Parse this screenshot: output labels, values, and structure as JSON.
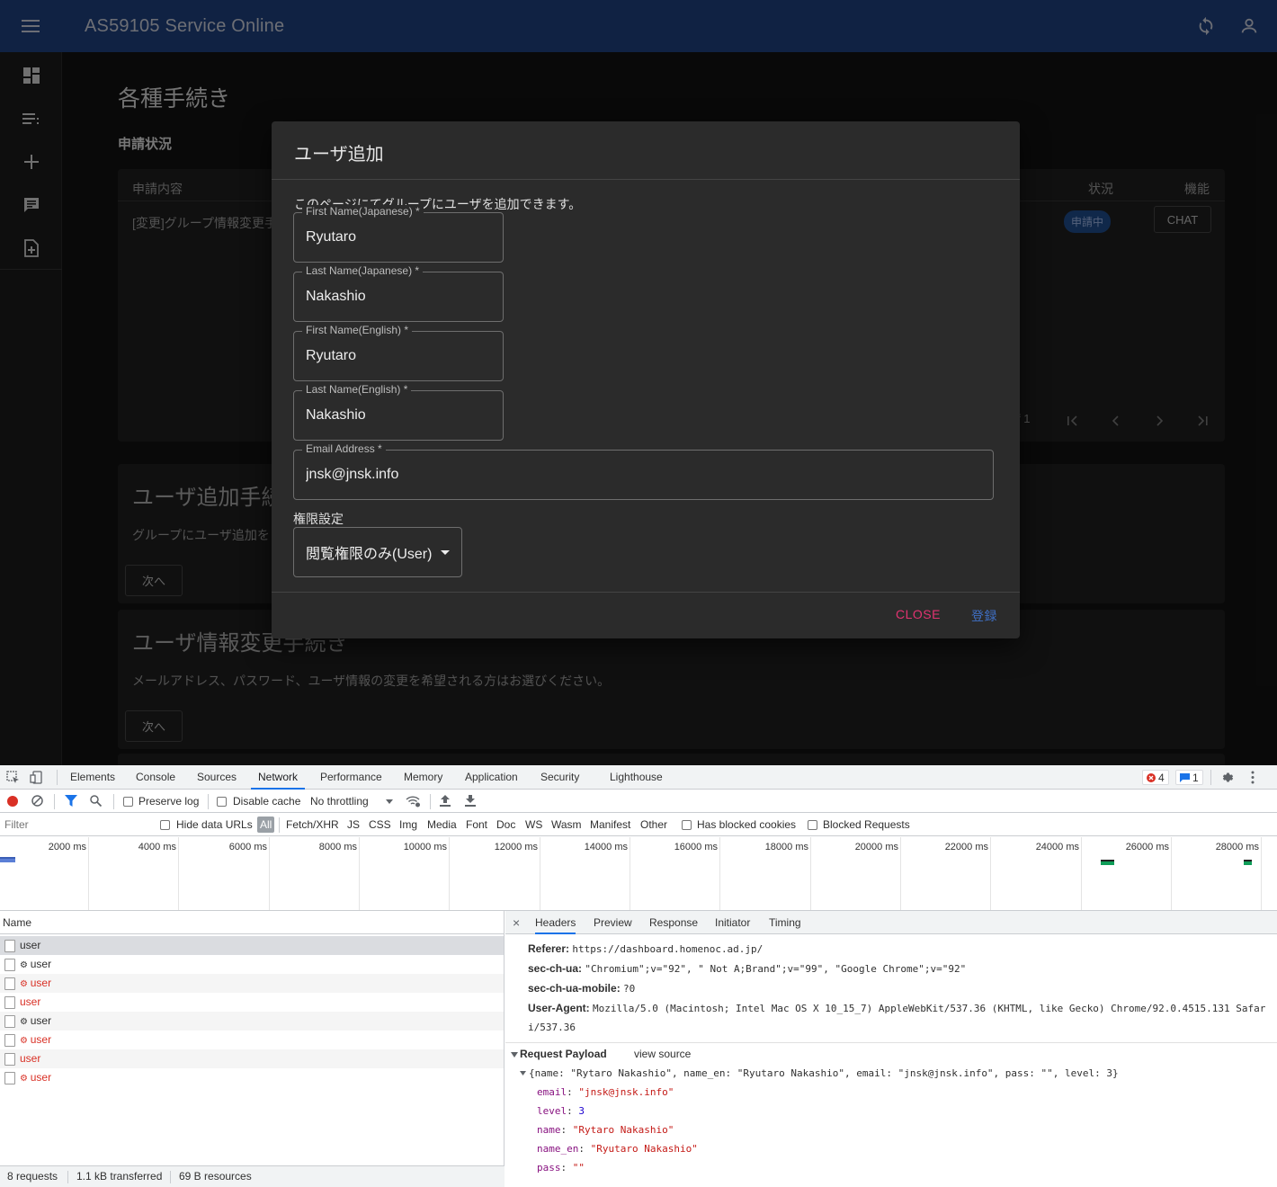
{
  "app": {
    "title": "AS59105 Service Online",
    "page_title": "各種手続き",
    "section_title": "申請状況",
    "table": {
      "col_content": "申請内容",
      "col_status": "状況",
      "col_function": "機能",
      "row_content": "[変更]グループ情報変更手",
      "row_status": "申請中",
      "row_button": "CHAT",
      "pagination": "f 1"
    },
    "cards": [
      {
        "title": "ユーザ追加手続",
        "desc": "グループにユーザ追加を",
        "button": "次へ"
      },
      {
        "title": "ユーザ情報変更手続き",
        "desc": "メールアドレス、パスワード、ユーザ情報の変更を希望される方はお選びください。",
        "button": "次へ"
      }
    ]
  },
  "dialog": {
    "title": "ユーザ追加",
    "description": "このページにてグループにユーザを追加できます。",
    "fields": [
      {
        "label": "First Name(Japanese) *",
        "value": "Ryutaro"
      },
      {
        "label": "Last Name(Japanese) *",
        "value": "Nakashio"
      },
      {
        "label": "First Name(English) *",
        "value": "Ryutaro"
      },
      {
        "label": "Last Name(English) *",
        "value": "Nakashio"
      },
      {
        "label": "Email Address *",
        "value": "jnsk@jnsk.info"
      }
    ],
    "permission_label": "権限設定",
    "permission_value": "閲覧権限のみ(User)",
    "close_label": "CLOSE",
    "submit_label": "登録",
    "colors": {
      "close": "#e33371",
      "submit": "#3f6fc4"
    }
  },
  "devtools": {
    "tabs": [
      "Elements",
      "Console",
      "Sources",
      "Network",
      "Performance",
      "Memory",
      "Application",
      "Security",
      "Lighthouse"
    ],
    "active_tab": "Network",
    "error_count": "4",
    "message_count": "1",
    "toolbar": {
      "preserve_log": "Preserve log",
      "disable_cache": "Disable cache",
      "throttling": "No throttling"
    },
    "filter": {
      "placeholder": "Filter",
      "hide_data_urls": "Hide data URLs",
      "types": [
        "All",
        "Fetch/XHR",
        "JS",
        "CSS",
        "Img",
        "Media",
        "Font",
        "Doc",
        "WS",
        "Wasm",
        "Manifest",
        "Other"
      ],
      "has_blocked_cookies": "Has blocked cookies",
      "blocked_requests": "Blocked Requests"
    },
    "timeline_ticks": [
      "2000 ms",
      "4000 ms",
      "6000 ms",
      "8000 ms",
      "10000 ms",
      "12000 ms",
      "14000 ms",
      "16000 ms",
      "18000 ms",
      "20000 ms",
      "22000 ms",
      "24000 ms",
      "26000 ms",
      "28000 ms"
    ],
    "name_header": "Name",
    "requests": [
      {
        "name": "user",
        "gear": false,
        "error": false
      },
      {
        "name": "user",
        "gear": true,
        "error": false
      },
      {
        "name": "user",
        "gear": true,
        "error": true
      },
      {
        "name": "user",
        "gear": false,
        "error": true
      },
      {
        "name": "user",
        "gear": true,
        "error": false
      },
      {
        "name": "user",
        "gear": true,
        "error": true
      },
      {
        "name": "user",
        "gear": false,
        "error": true
      },
      {
        "name": "user",
        "gear": true,
        "error": true
      }
    ],
    "status": {
      "requests": "8 requests",
      "transferred": "1.1 kB transferred",
      "resources": "69 B resources"
    },
    "detail_tabs": [
      "Headers",
      "Preview",
      "Response",
      "Initiator",
      "Timing"
    ],
    "active_detail_tab": "Headers",
    "headers": [
      {
        "key": "Referer:",
        "value": "https://dashboard.homenoc.ad.jp/"
      },
      {
        "key": "sec-ch-ua:",
        "value": "\"Chromium\";v=\"92\", \" Not A;Brand\";v=\"99\", \"Google Chrome\";v=\"92\""
      },
      {
        "key": "sec-ch-ua-mobile:",
        "value": "?0"
      },
      {
        "key": "User-Agent:",
        "value": "Mozilla/5.0 (Macintosh; Intel Mac OS X 10_15_7) AppleWebKit/537.36 (KHTML, like Gecko) Chrome/92.0.4515.131 Safar"
      }
    ],
    "ua_continuation": "i/537.36",
    "payload": {
      "title": "Request Payload",
      "view_source": "view source",
      "summary": "{name: \"Rytaro Nakashio\", name_en: \"Ryutaro Nakashio\", email: \"jnsk@jnsk.info\", pass: \"\", level: 3}",
      "props": [
        {
          "key": "email",
          "value": "\"jnsk@jnsk.info\"",
          "kind": "str"
        },
        {
          "key": "level",
          "value": "3",
          "kind": "num"
        },
        {
          "key": "name",
          "value": "\"Rytaro Nakashio\"",
          "kind": "str"
        },
        {
          "key": "name_en",
          "value": "\"Ryutaro Nakashio\"",
          "kind": "str"
        },
        {
          "key": "pass",
          "value": "\"\"",
          "kind": "str"
        }
      ]
    }
  }
}
